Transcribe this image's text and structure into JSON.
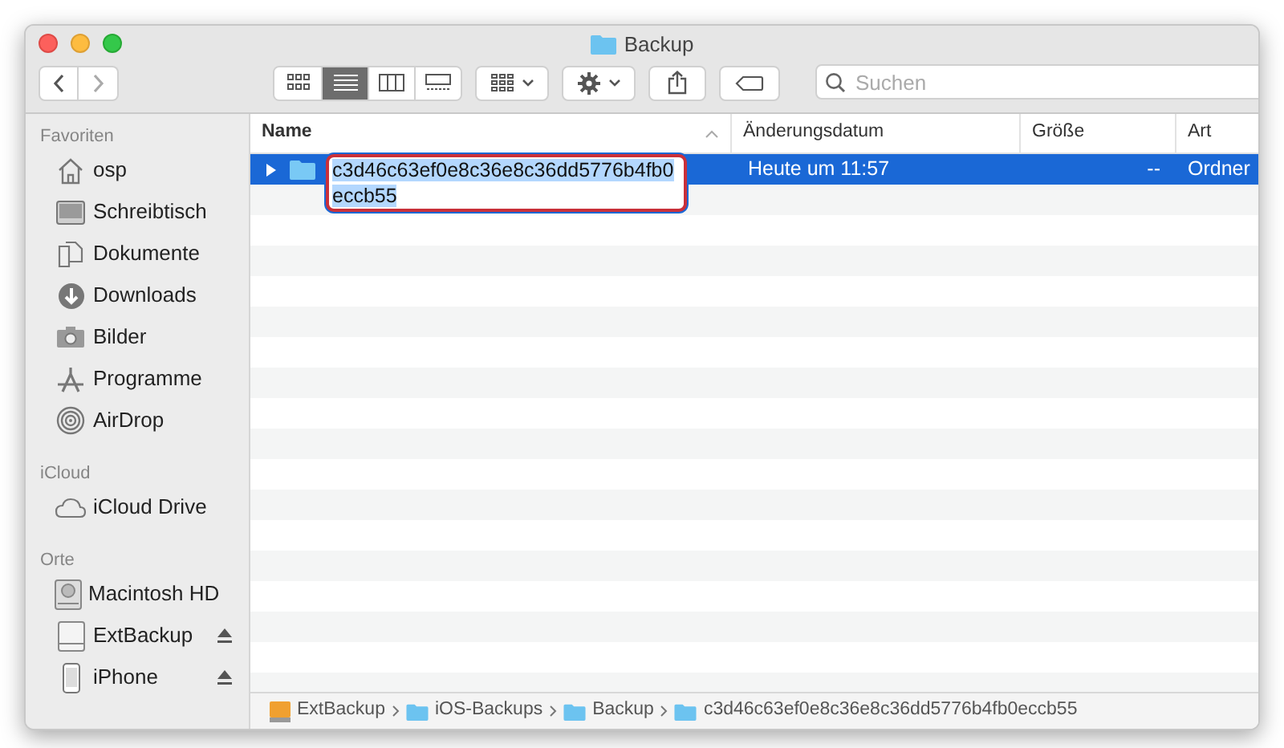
{
  "window": {
    "title": "Backup"
  },
  "toolbar": {
    "view_modes": [
      {
        "kind": "icons",
        "selected": false
      },
      {
        "kind": "list",
        "selected": true
      },
      {
        "kind": "columns",
        "selected": false
      },
      {
        "kind": "gallery",
        "selected": false
      }
    ],
    "search": {
      "placeholder": "Suchen"
    }
  },
  "sidebar": {
    "sections": [
      {
        "title": "Favoriten",
        "items": [
          {
            "label": "osp",
            "kind": "home"
          },
          {
            "label": "Schreibtisch",
            "kind": "desktop"
          },
          {
            "label": "Dokumente",
            "kind": "documents"
          },
          {
            "label": "Downloads",
            "kind": "downloads"
          },
          {
            "label": "Bilder",
            "kind": "pictures"
          },
          {
            "label": "Programme",
            "kind": "apps"
          },
          {
            "label": "AirDrop",
            "kind": "airdrop"
          }
        ]
      },
      {
        "title": "iCloud",
        "items": [
          {
            "label": "iCloud Drive",
            "kind": "cloud"
          }
        ]
      },
      {
        "title": "Orte",
        "items": [
          {
            "label": "Macintosh HD",
            "kind": "disk",
            "ejectable": false
          },
          {
            "label": "ExtBackup",
            "kind": "external",
            "ejectable": true
          },
          {
            "label": "iPhone",
            "kind": "phone",
            "ejectable": true
          }
        ]
      }
    ]
  },
  "table": {
    "columns": [
      {
        "label": "Name",
        "sorted": true
      },
      {
        "label": "Änderungsdatum",
        "sorted": false
      },
      {
        "label": "Größe",
        "sorted": false
      },
      {
        "label": "Art",
        "sorted": false
      }
    ],
    "rows": [
      {
        "name": "c3d46c63ef0e8c36e8c36dd5776b4fb0eccb55",
        "modified": "Heute um 11:57",
        "size": "--",
        "kind": "Ordner",
        "selected": true,
        "editing": true,
        "expanded": false
      }
    ]
  },
  "path_bar": [
    {
      "label": "ExtBackup",
      "kind": "drive"
    },
    {
      "label": "iOS-Backups",
      "kind": "folder"
    },
    {
      "label": "Backup",
      "kind": "folder"
    },
    {
      "label": "c3d46c63ef0e8c36e8c36dd5776b4fb0eccb55",
      "kind": "folder"
    }
  ]
}
